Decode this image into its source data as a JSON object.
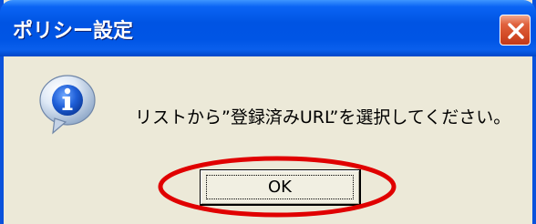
{
  "window": {
    "title": "ポリシー設定"
  },
  "dialog": {
    "message": "リストから”登録済みURL”を選択してください。",
    "icon": "information-icon",
    "ok_label": "OK"
  },
  "annotation": {
    "color": "#e00000",
    "target": "OK button"
  },
  "colors": {
    "titlebar": "#0054e3",
    "dialog_bg": "#ece9d8",
    "close_button": "#d24a25"
  }
}
